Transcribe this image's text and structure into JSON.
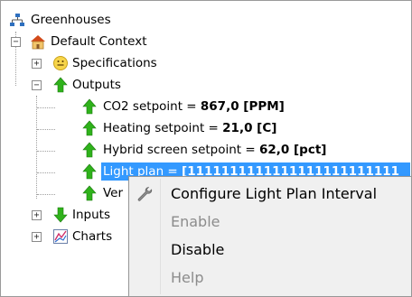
{
  "tree": {
    "root": {
      "label": "Greenhouses",
      "icon": "network-icon"
    },
    "context": {
      "label": "Default Context",
      "icon": "house-icon",
      "expander": "−"
    },
    "specifications": {
      "label": "Specifications",
      "icon": "smiley-icon",
      "expander": "+"
    },
    "outputs": {
      "label": "Outputs",
      "icon": "up-arrow-icon",
      "expander": "−",
      "children": [
        {
          "prefix": "CO2 setpoint = ",
          "value": "867,0 [PPM]"
        },
        {
          "prefix": "Heating setpoint = ",
          "value": "21,0 [C]"
        },
        {
          "prefix": "Hybrid screen setpoint = ",
          "value": "62,0 [pct]"
        },
        {
          "prefix": "Light plan = ",
          "value": "[1111111111111111111111111"
        },
        {
          "prefix": "Ver",
          "value": ""
        }
      ]
    },
    "inputs": {
      "label": "Inputs",
      "icon": "down-arrow-icon",
      "expander": "+"
    },
    "charts": {
      "label": "Charts",
      "icon": "chart-icon",
      "expander": "+"
    }
  },
  "context_menu": {
    "items": [
      {
        "label": "Configure Light Plan Interval",
        "enabled": true,
        "icon": "wrench-icon"
      },
      {
        "label": "Enable",
        "enabled": false
      },
      {
        "label": "Disable",
        "enabled": true
      },
      {
        "label": "Help",
        "enabled": false
      }
    ]
  },
  "colors": {
    "selection": "#3399ff",
    "arrow_green": "#2fb21b",
    "disabled_text": "#8c8c8c"
  }
}
